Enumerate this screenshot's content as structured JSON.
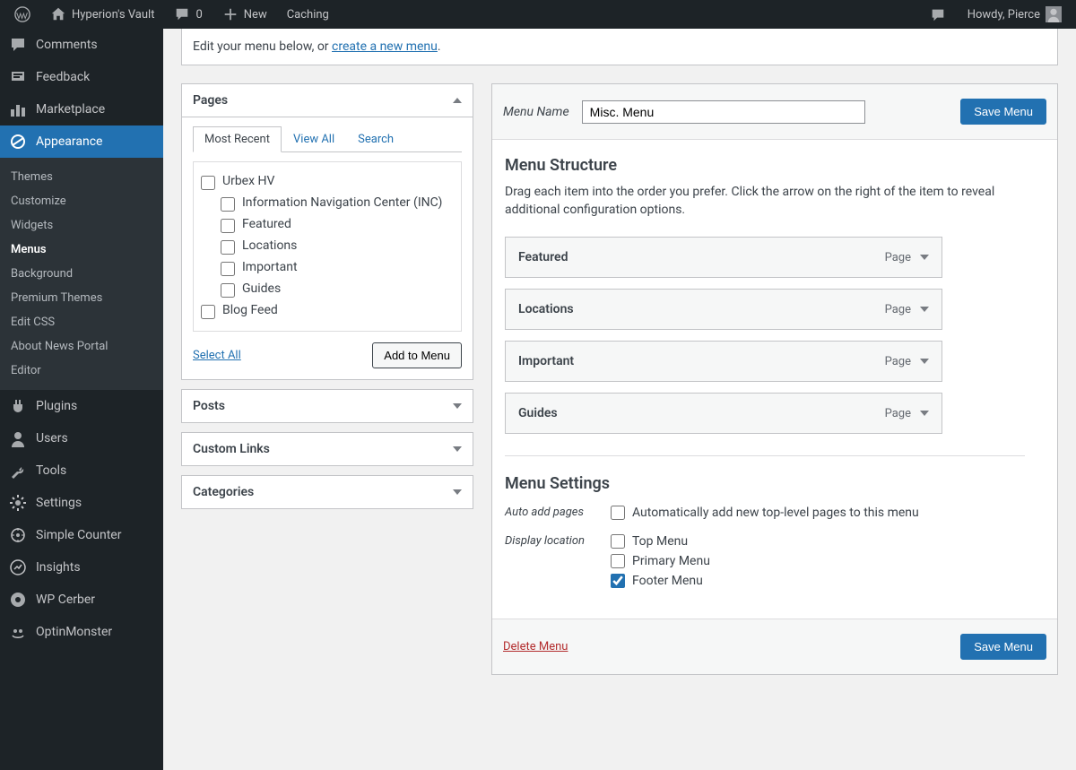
{
  "adminbar": {
    "site": "Hyperion's Vault",
    "comments": "0",
    "new": "New",
    "caching": "Caching",
    "howdy": "Howdy, Pierce"
  },
  "sidebar": {
    "top": [
      {
        "id": "comments",
        "label": "Comments"
      },
      {
        "id": "feedback",
        "label": "Feedback"
      },
      {
        "id": "marketplace",
        "label": "Marketplace"
      },
      {
        "id": "appearance",
        "label": "Appearance"
      }
    ],
    "appearance_sub": [
      {
        "id": "themes",
        "label": "Themes"
      },
      {
        "id": "customize",
        "label": "Customize"
      },
      {
        "id": "widgets",
        "label": "Widgets"
      },
      {
        "id": "menus",
        "label": "Menus"
      },
      {
        "id": "background",
        "label": "Background"
      },
      {
        "id": "premium",
        "label": "Premium Themes"
      },
      {
        "id": "editcss",
        "label": "Edit CSS"
      },
      {
        "id": "aboutnp",
        "label": "About News Portal"
      },
      {
        "id": "editor",
        "label": "Editor"
      }
    ],
    "bottom": [
      {
        "id": "plugins",
        "label": "Plugins"
      },
      {
        "id": "users",
        "label": "Users"
      },
      {
        "id": "tools",
        "label": "Tools"
      },
      {
        "id": "settings",
        "label": "Settings"
      },
      {
        "id": "simplecounter",
        "label": "Simple Counter"
      },
      {
        "id": "insights",
        "label": "Insights"
      },
      {
        "id": "wpcerber",
        "label": "WP Cerber"
      },
      {
        "id": "optinmonster",
        "label": "OptinMonster"
      }
    ]
  },
  "notice": {
    "prefix": "Edit your menu below, or ",
    "link": "create a new menu",
    "suffix": "."
  },
  "boxes": {
    "pages": "Pages",
    "tab_recent": "Most Recent",
    "tab_viewall": "View All",
    "tab_search": "Search",
    "items": [
      {
        "label": "Urbex HV",
        "indent": 0
      },
      {
        "label": "Information Navigation Center (INC)",
        "indent": 1
      },
      {
        "label": "Featured",
        "indent": 1
      },
      {
        "label": "Locations",
        "indent": 1
      },
      {
        "label": "Important",
        "indent": 1
      },
      {
        "label": "Guides",
        "indent": 1
      },
      {
        "label": "Blog Feed",
        "indent": 0
      }
    ],
    "select_all": "Select All",
    "add_to_menu": "Add to Menu",
    "posts": "Posts",
    "custom_links": "Custom Links",
    "categories": "Categories"
  },
  "menu": {
    "name_label": "Menu Name",
    "name_value": "Misc. Menu",
    "save": "Save Menu",
    "structure_h": "Menu Structure",
    "structure_p": "Drag each item into the order you prefer. Click the arrow on the right of the item to reveal additional configuration options.",
    "items": [
      {
        "title": "Featured",
        "type": "Page"
      },
      {
        "title": "Locations",
        "type": "Page"
      },
      {
        "title": "Important",
        "type": "Page"
      },
      {
        "title": "Guides",
        "type": "Page"
      }
    ],
    "settings_h": "Menu Settings",
    "auto_label": "Auto add pages",
    "auto_opt": "Automatically add new top-level pages to this menu",
    "loc_label": "Display location",
    "loc_opts": [
      {
        "label": "Top Menu",
        "checked": false
      },
      {
        "label": "Primary Menu",
        "checked": false
      },
      {
        "label": "Footer Menu",
        "checked": true
      }
    ],
    "delete": "Delete Menu"
  }
}
